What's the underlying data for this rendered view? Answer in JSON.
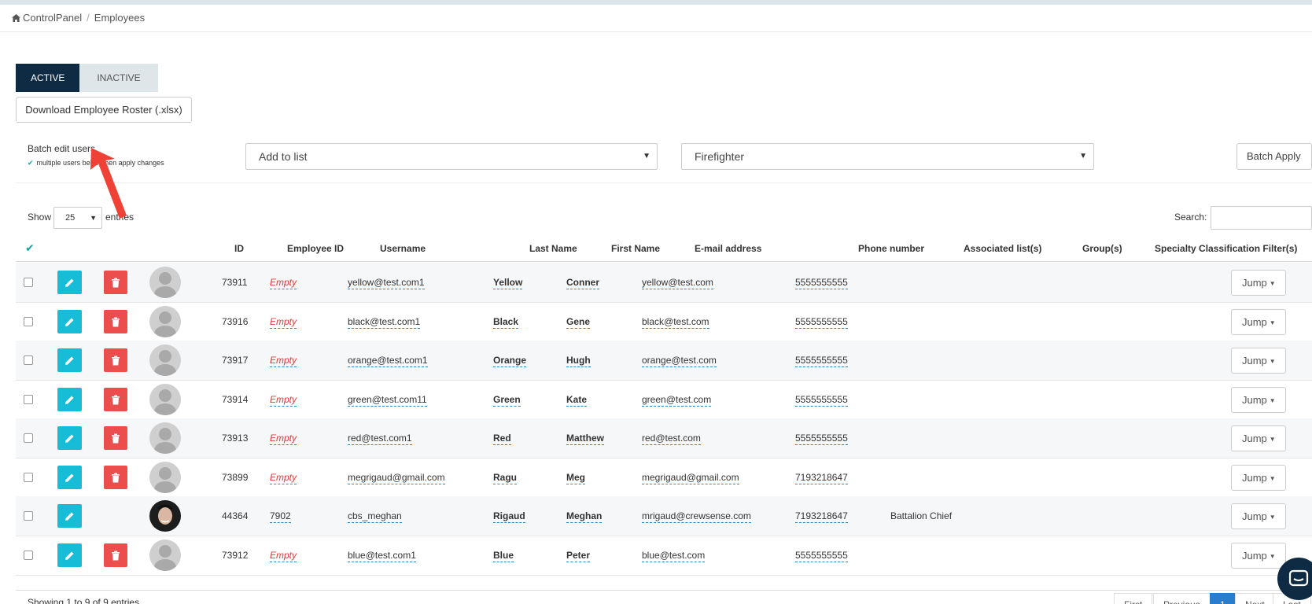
{
  "breadcrumb": {
    "home": "ControlPanel",
    "current": "Employees"
  },
  "tabs": [
    {
      "label": "ACTIVE",
      "active": true
    },
    {
      "label": "INACTIVE",
      "active": false
    }
  ],
  "download_button": "Download Employee Roster (.xlsx)",
  "batch": {
    "title": "Batch edit users",
    "hint_check": "✔",
    "hint": "multiple users below then apply changes",
    "list_select": "Add to list",
    "role_select": "Firefighter",
    "apply_button": "Batch Apply"
  },
  "table_controls": {
    "show_label": "Show",
    "page_size": "25",
    "entries_label": "entries",
    "search_label": "Search:",
    "search_value": ""
  },
  "columns": {
    "check_all": "✔",
    "id": "ID",
    "employee_id": "Employee ID",
    "username": "Username",
    "last_name": "Last Name",
    "first_name": "First Name",
    "email": "E-mail address",
    "phone": "Phone number",
    "associated_lists": "Associated list(s)",
    "groups": "Group(s)",
    "specialty": "Specialty Classification Filter(s)"
  },
  "rows": [
    {
      "id": "73911",
      "employee_id": "Empty",
      "username": "yellow@test.com1",
      "last_name": "Yellow",
      "first_name": "Conner",
      "email": "yellow@test.com",
      "phone": "5555555555",
      "lists": "",
      "groups": "",
      "has_photo": false,
      "can_delete": true,
      "jump": "Jump"
    },
    {
      "id": "73916",
      "employee_id": "Empty",
      "username": "black@test.com1",
      "last_name": "Black",
      "first_name": "Gene",
      "email": "black@test.com",
      "phone": "5555555555",
      "lists": "",
      "groups": "",
      "has_photo": false,
      "can_delete": true,
      "jump": "Jump"
    },
    {
      "id": "73917",
      "employee_id": "Empty",
      "username": "orange@test.com1",
      "last_name": "Orange",
      "first_name": "Hugh",
      "email": "orange@test.com",
      "phone": "5555555555",
      "lists": "",
      "groups": "",
      "has_photo": false,
      "can_delete": true,
      "jump": "Jump"
    },
    {
      "id": "73914",
      "employee_id": "Empty",
      "username": "green@test.com11",
      "last_name": "Green",
      "first_name": "Kate",
      "email": "green@test.com",
      "phone": "5555555555",
      "lists": "",
      "groups": "",
      "has_photo": false,
      "can_delete": true,
      "jump": "Jump"
    },
    {
      "id": "73913",
      "employee_id": "Empty",
      "username": "red@test.com1",
      "last_name": "Red",
      "first_name": "Matthew",
      "email": "red@test.com",
      "phone": "5555555555",
      "lists": "",
      "groups": "",
      "has_photo": false,
      "can_delete": true,
      "jump": "Jump"
    },
    {
      "id": "73899",
      "employee_id": "Empty",
      "username": "megrigaud@gmail.com",
      "last_name": "Ragu",
      "first_name": "Meg",
      "email": "megrigaud@gmail.com",
      "phone": "7193218647",
      "lists": "",
      "groups": "",
      "has_photo": false,
      "can_delete": true,
      "jump": "Jump"
    },
    {
      "id": "44364",
      "employee_id": "7902",
      "username": "cbs_meghan",
      "last_name": "Rigaud",
      "first_name": "Meghan",
      "email": "mrigaud@crewsense.com",
      "phone": "7193218647",
      "lists": "Battalion Chief",
      "groups": "",
      "has_photo": true,
      "can_delete": false,
      "jump": "Jump"
    },
    {
      "id": "73912",
      "employee_id": "Empty",
      "username": "blue@test.com1",
      "last_name": "Blue",
      "first_name": "Peter",
      "email": "blue@test.com",
      "phone": "5555555555",
      "lists": "",
      "groups": "",
      "has_photo": false,
      "can_delete": true,
      "jump": "Jump"
    }
  ],
  "footer": {
    "info": "Showing 1 to 9 of 9 entries",
    "pager": [
      "First",
      "Previous",
      "1",
      "Next",
      "Last"
    ]
  }
}
